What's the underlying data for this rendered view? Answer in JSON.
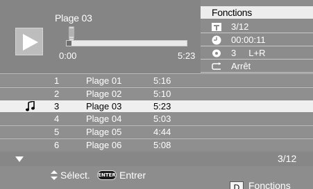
{
  "player": {
    "track_title": "Plage 03",
    "time_start": "0:00",
    "time_end": "5:23",
    "progress": 0.04
  },
  "functions": {
    "header": "Fonctions",
    "rows": [
      {
        "icon": "track-icon",
        "text": "3/12"
      },
      {
        "icon": "clock-icon",
        "text": "00:00:11"
      },
      {
        "icon": "audio-icon",
        "text": "3     L+R"
      },
      {
        "icon": "repeat-icon",
        "text": "Arrêt"
      }
    ]
  },
  "tracks": [
    {
      "num": "1",
      "name": "Plage 01",
      "duration": "5:16"
    },
    {
      "num": "2",
      "name": "Plage 02",
      "duration": "5:10"
    },
    {
      "num": "3",
      "name": "Plage 03",
      "duration": "5:23",
      "selected": true,
      "icon": "music-note-icon"
    },
    {
      "num": "4",
      "name": "Plage 04",
      "duration": "5:03"
    },
    {
      "num": "5",
      "name": "Plage 05",
      "duration": "4:44"
    },
    {
      "num": "6",
      "name": "Plage 06",
      "duration": "5:08"
    }
  ],
  "list_footer": {
    "count": "3/12"
  },
  "hints": {
    "select": "Sélect.",
    "enter_badge": "ENTER",
    "enter": "Entrer",
    "func_key": "D",
    "func_label": "Fonctions"
  },
  "colors": {
    "background": "#8a8a8a",
    "selected_row": "#efefef",
    "header_bg": "#ededed"
  }
}
